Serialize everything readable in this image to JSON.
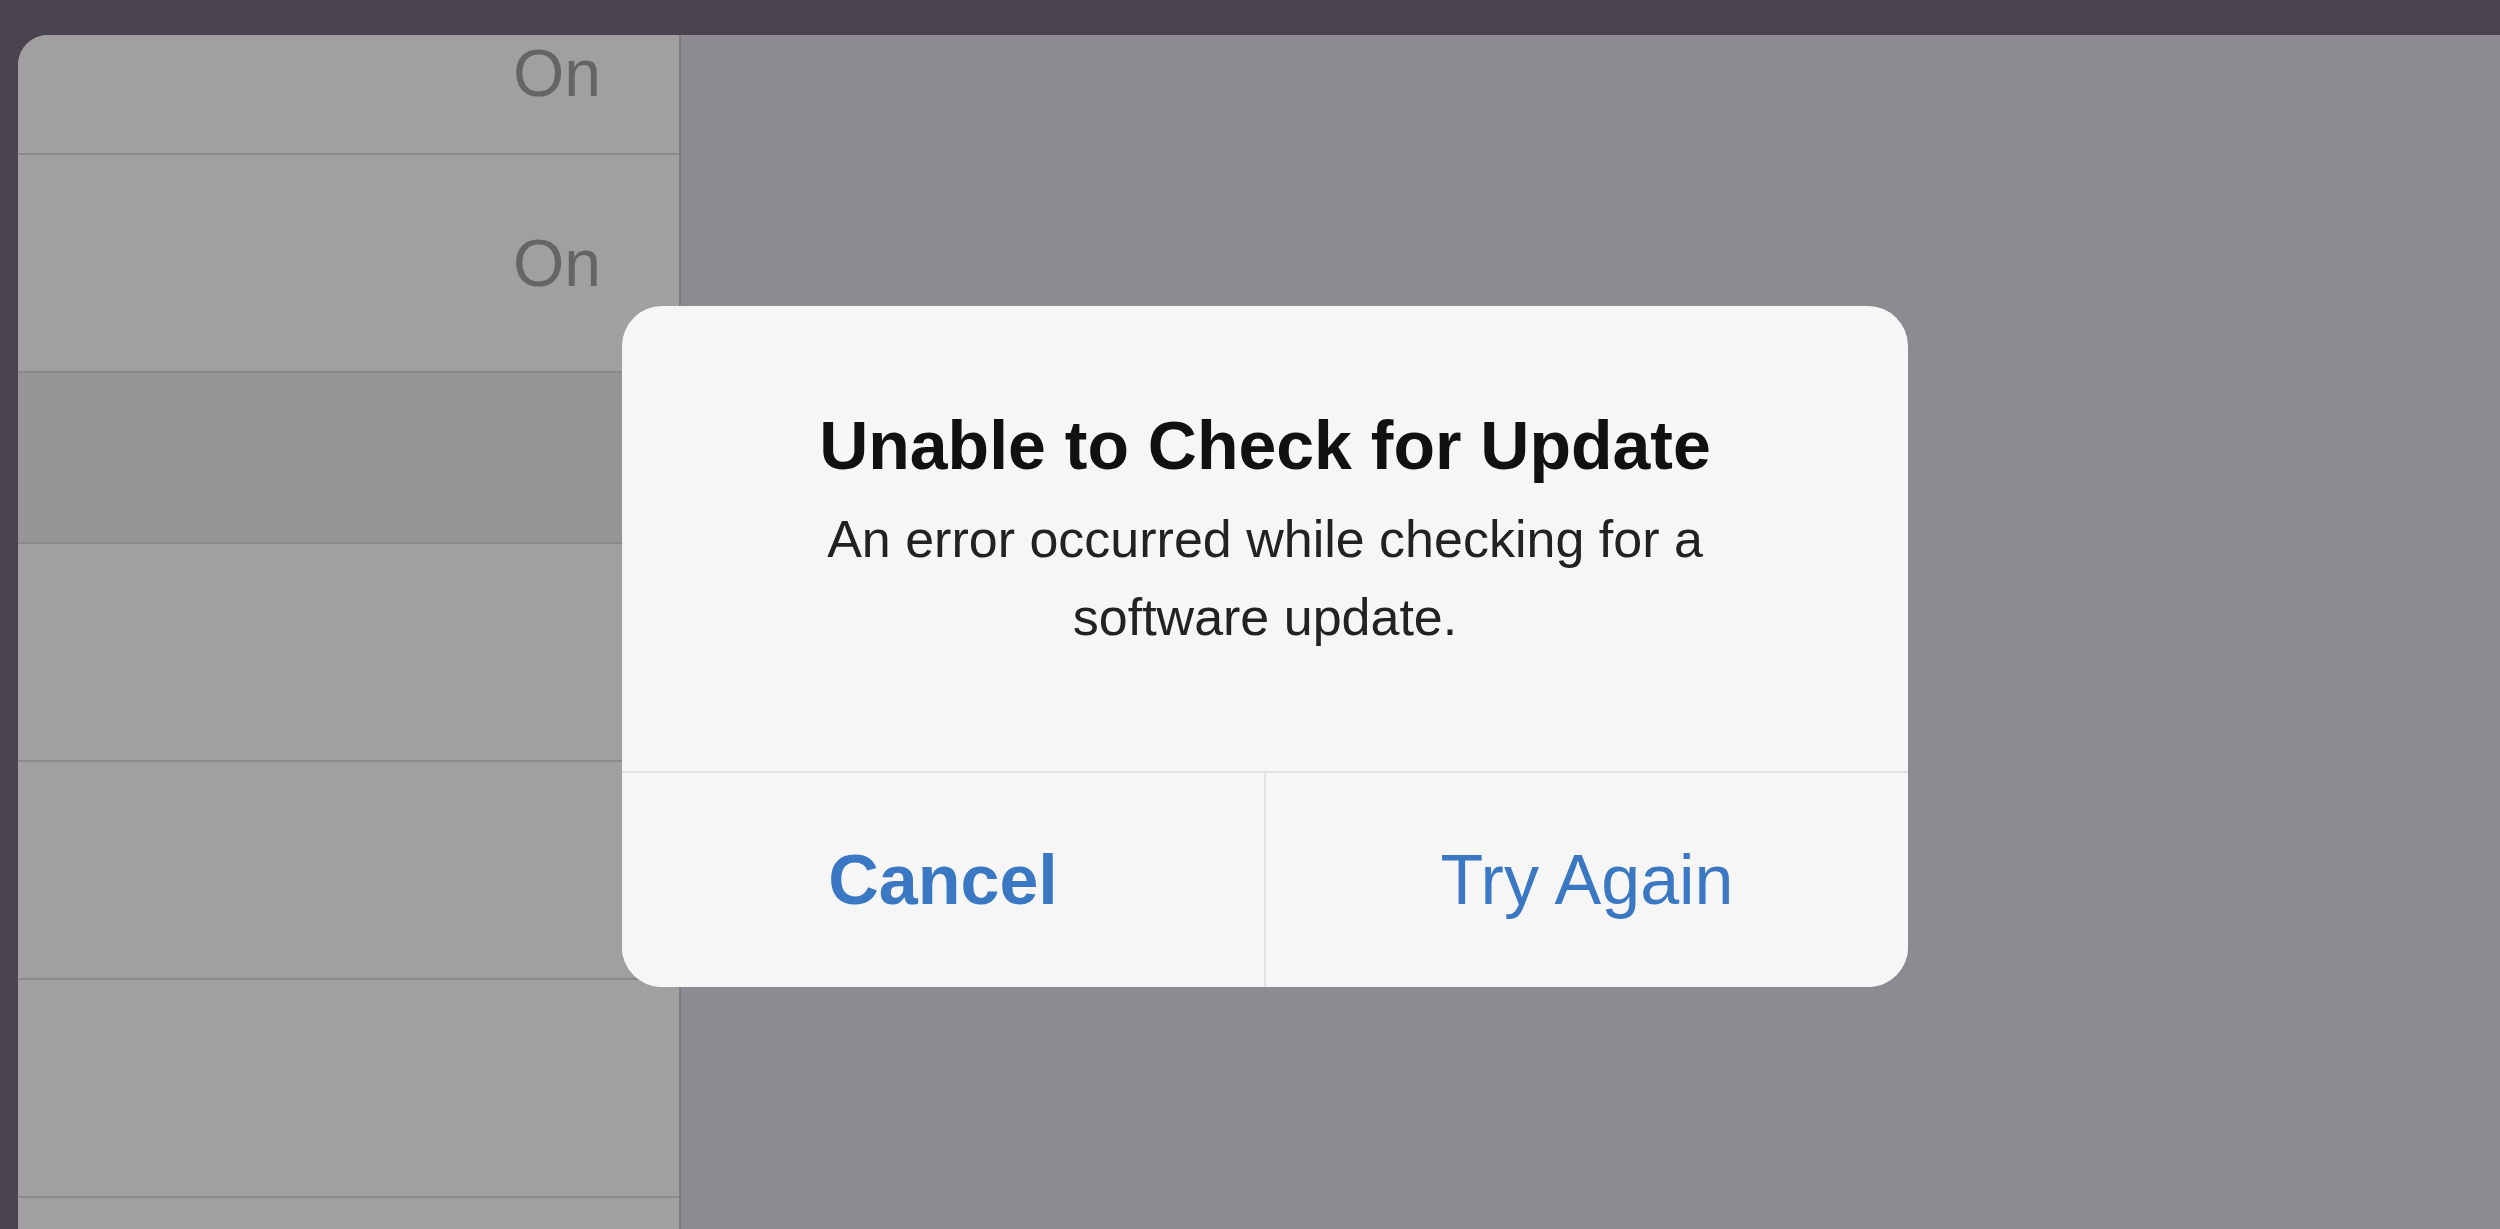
{
  "sidebar": {
    "rows": [
      {
        "kind": "row",
        "value": "On"
      },
      {
        "kind": "row",
        "value": "On"
      },
      {
        "kind": "gap"
      },
      {
        "kind": "row"
      },
      {
        "kind": "row"
      },
      {
        "kind": "row"
      },
      {
        "kind": "row"
      }
    ]
  },
  "alert": {
    "title": "Unable to Check for Update",
    "message": "An error occurred while checking for a software update.",
    "buttons": [
      {
        "label": "Cancel",
        "preferred": true
      },
      {
        "label": "Try Again",
        "preferred": false
      }
    ]
  }
}
